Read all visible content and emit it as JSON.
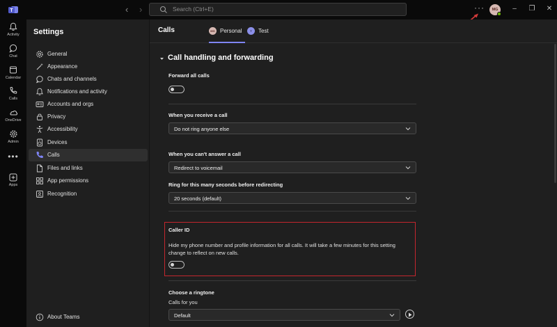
{
  "topbar": {
    "search_placeholder": "Search (Ctrl+E)",
    "more_label": "···",
    "avatar_initials": "MG"
  },
  "rail": {
    "items": [
      {
        "label": "Activity",
        "icon": "bell-icon"
      },
      {
        "label": "Chat",
        "icon": "chat-icon"
      },
      {
        "label": "Calendar",
        "icon": "calendar-icon"
      },
      {
        "label": "Calls",
        "icon": "phone-icon"
      },
      {
        "label": "OneDrive",
        "icon": "cloud-icon"
      },
      {
        "label": "Admin",
        "icon": "admin-gear-icon"
      },
      {
        "label": "Apps",
        "icon": "apps-plus-icon"
      }
    ],
    "more_label": "•••"
  },
  "settings": {
    "title": "Settings",
    "nav": [
      {
        "label": "General",
        "icon": "gear-icon",
        "active": false
      },
      {
        "label": "Appearance",
        "icon": "wand-icon",
        "active": false
      },
      {
        "label": "Chats and channels",
        "icon": "chat-icon",
        "active": false
      },
      {
        "label": "Notifications and activity",
        "icon": "bell-icon",
        "active": false
      },
      {
        "label": "Accounts and orgs",
        "icon": "id-card-icon",
        "active": false
      },
      {
        "label": "Privacy",
        "icon": "lock-icon",
        "active": false
      },
      {
        "label": "Accessibility",
        "icon": "accessibility-icon",
        "active": false
      },
      {
        "label": "Devices",
        "icon": "speaker-icon",
        "active": false
      },
      {
        "label": "Calls",
        "icon": "phone-icon",
        "active": true
      },
      {
        "label": "Files and links",
        "icon": "document-icon",
        "active": false
      },
      {
        "label": "App permissions",
        "icon": "apps-icon",
        "active": false
      },
      {
        "label": "Recognition",
        "icon": "recognition-icon",
        "active": false
      }
    ],
    "about_label": "About Teams"
  },
  "content": {
    "title": "Calls",
    "tabs": [
      {
        "label": "Personal",
        "initials": "MG",
        "selected": true
      },
      {
        "label": "Test",
        "initials": "T",
        "selected": false
      }
    ],
    "section_title": "Call handling and forwarding",
    "forward_all": {
      "label": "Forward all calls",
      "on": false
    },
    "receive_call": {
      "label": "When you receive a call",
      "value": "Do not ring anyone else"
    },
    "cant_answer": {
      "label": "When you can't answer a call",
      "value": "Redirect to voicemail"
    },
    "ring_seconds": {
      "label": "Ring for this many seconds before redirecting",
      "value": "20 seconds (default)"
    },
    "caller_id": {
      "label": "Caller ID",
      "description": "Hide my phone number and profile information for all calls. It will take a few minutes for this setting change to reflect on new calls.",
      "on": false
    },
    "ringtone": {
      "title": "Choose a ringtone",
      "sub_label": "Calls for you",
      "value": "Default"
    }
  },
  "colors": {
    "accent": "#7f85f5",
    "highlight": "#c4262e",
    "presence": "#6bb700"
  }
}
